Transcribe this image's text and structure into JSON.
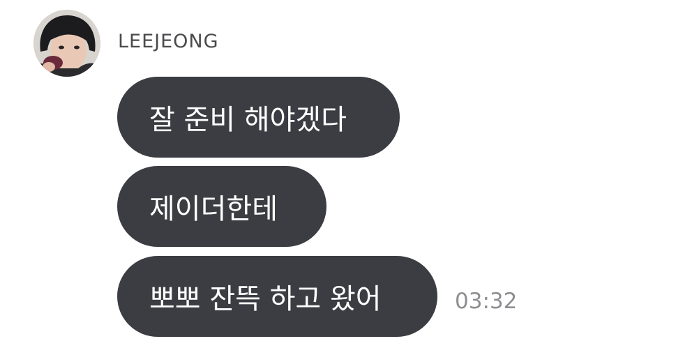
{
  "sender": {
    "name": "LEEJEONG",
    "avatar_icon": "profile-photo"
  },
  "messages": [
    {
      "text": "잘 준비 해야겠다"
    },
    {
      "text": "제이더한테"
    },
    {
      "text": "뽀뽀 잔뜩 하고 왔어"
    }
  ],
  "timestamp": "03:32",
  "colors": {
    "bubble_bg": "#3c3d43",
    "bubble_text": "#ffffff",
    "name_text": "#4a4a4c",
    "timestamp_text": "#8e8e92",
    "background": "#ffffff"
  }
}
